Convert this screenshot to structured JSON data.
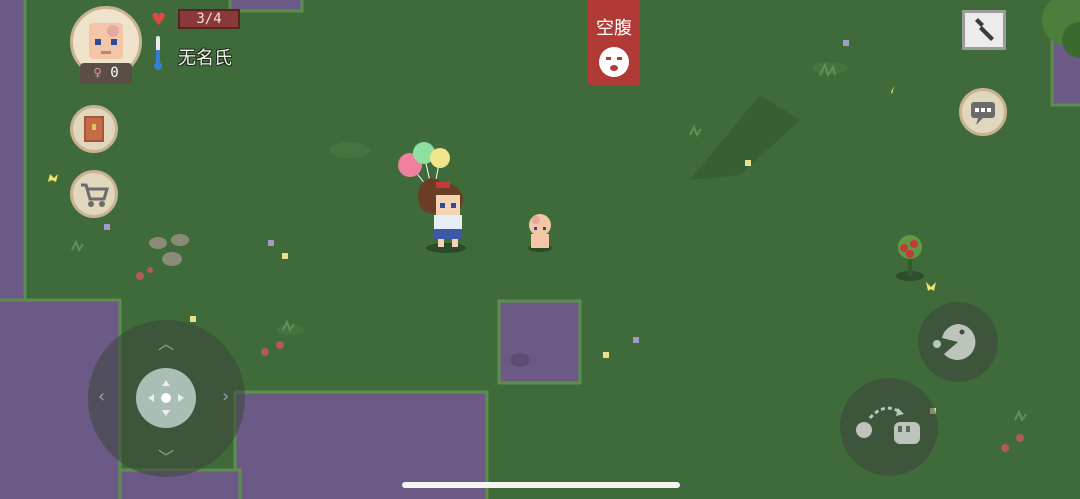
{
  "hud": {
    "health_text": "3/4",
    "player_name": "无名氏",
    "gender_symbol": "♀",
    "gender_count": "0"
  },
  "status": {
    "hunger_label": "空腹"
  },
  "icons": {
    "settings": "wrench-icon",
    "chat": "chat-bubble-icon",
    "journal": "book-icon",
    "shop": "cart-icon",
    "eat": "eat-icon",
    "throw": "throw-icon",
    "joystick": "dpad-icon"
  },
  "colors": {
    "grass": "#3f6b3b",
    "water": "#6c5a86",
    "hunger": "#b23a36",
    "health": "#8a3838"
  }
}
